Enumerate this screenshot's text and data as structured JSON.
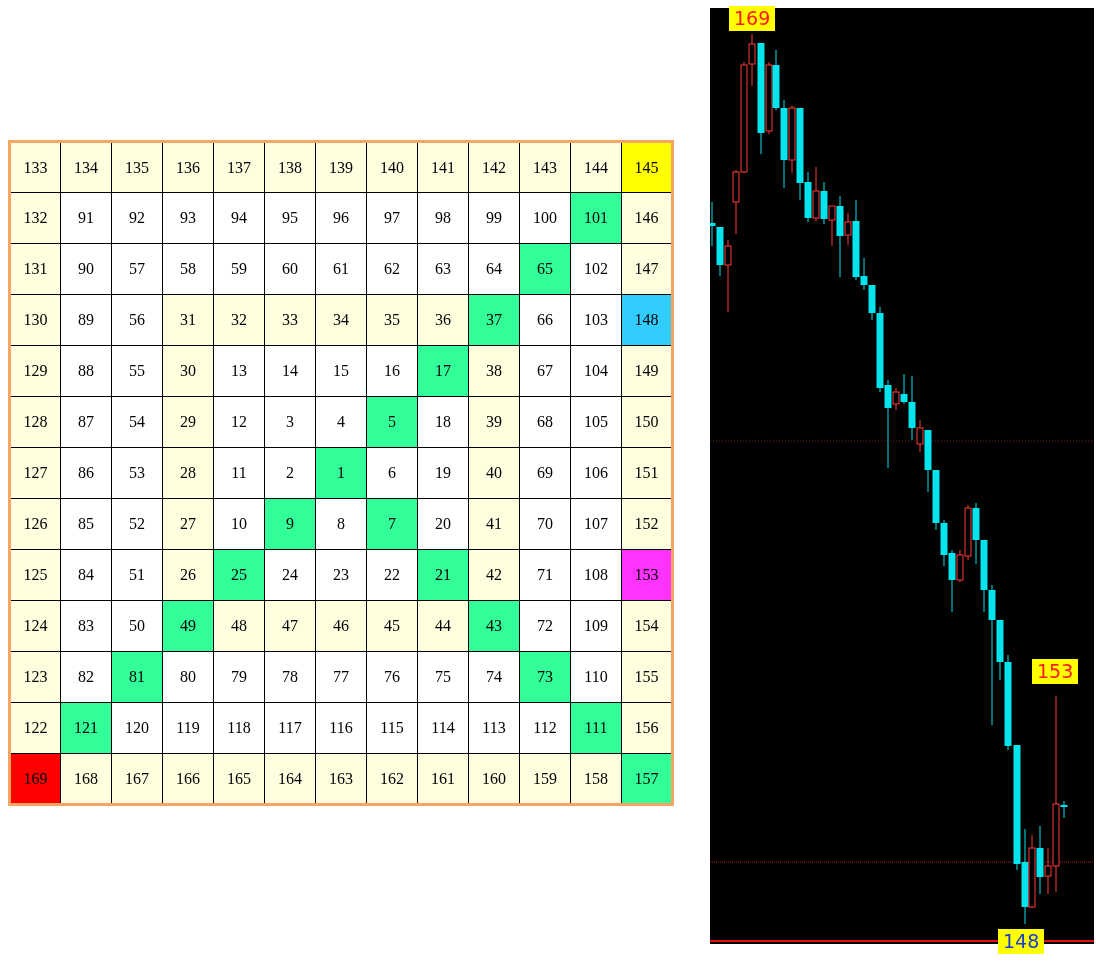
{
  "square": {
    "rows": [
      [
        {
          "text": "133",
          "color": "#ffffe0"
        },
        {
          "text": "134",
          "color": "#ffffe0"
        },
        {
          "text": "135",
          "color": "#ffffe0"
        },
        {
          "text": "136",
          "color": "#ffffe0"
        },
        {
          "text": "137",
          "color": "#ffffe0"
        },
        {
          "text": "138",
          "color": "#ffffe0"
        },
        {
          "text": "139",
          "color": "#ffffe0"
        },
        {
          "text": "140",
          "color": "#ffffe0"
        },
        {
          "text": "141",
          "color": "#ffffe0"
        },
        {
          "text": "142",
          "color": "#ffffe0"
        },
        {
          "text": "143",
          "color": "#ffffe0"
        },
        {
          "text": "144",
          "color": "#ffffe0"
        },
        {
          "text": "145",
          "color": "#ffff00"
        }
      ],
      [
        {
          "text": "132",
          "color": "#ffffe0"
        },
        {
          "text": "91",
          "color": "#ffffff"
        },
        {
          "text": "92",
          "color": "#ffffff"
        },
        {
          "text": "93",
          "color": "#ffffff"
        },
        {
          "text": "94",
          "color": "#ffffff"
        },
        {
          "text": "95",
          "color": "#ffffff"
        },
        {
          "text": "96",
          "color": "#ffffff"
        },
        {
          "text": "97",
          "color": "#ffffff"
        },
        {
          "text": "98",
          "color": "#ffffff"
        },
        {
          "text": "99",
          "color": "#ffffff"
        },
        {
          "text": "100",
          "color": "#ffffff"
        },
        {
          "text": "101",
          "color": "#33ff99"
        },
        {
          "text": "146",
          "color": "#ffffe0"
        }
      ],
      [
        {
          "text": "131",
          "color": "#ffffe0"
        },
        {
          "text": "90",
          "color": "#ffffff"
        },
        {
          "text": "57",
          "color": "#ffffff"
        },
        {
          "text": "58",
          "color": "#ffffff"
        },
        {
          "text": "59",
          "color": "#ffffff"
        },
        {
          "text": "60",
          "color": "#ffffff"
        },
        {
          "text": "61",
          "color": "#ffffff"
        },
        {
          "text": "62",
          "color": "#ffffff"
        },
        {
          "text": "63",
          "color": "#ffffff"
        },
        {
          "text": "64",
          "color": "#ffffff"
        },
        {
          "text": "65",
          "color": "#33ff99"
        },
        {
          "text": "102",
          "color": "#ffffff"
        },
        {
          "text": "147",
          "color": "#ffffe0"
        }
      ],
      [
        {
          "text": "130",
          "color": "#ffffe0"
        },
        {
          "text": "89",
          "color": "#ffffff"
        },
        {
          "text": "56",
          "color": "#ffffff"
        },
        {
          "text": "31",
          "color": "#ffffe0"
        },
        {
          "text": "32",
          "color": "#ffffe0"
        },
        {
          "text": "33",
          "color": "#ffffe0"
        },
        {
          "text": "34",
          "color": "#ffffe0"
        },
        {
          "text": "35",
          "color": "#ffffe0"
        },
        {
          "text": "36",
          "color": "#ffffe0"
        },
        {
          "text": "37",
          "color": "#33ff99"
        },
        {
          "text": "66",
          "color": "#ffffff"
        },
        {
          "text": "103",
          "color": "#ffffff"
        },
        {
          "text": "148",
          "color": "#33ccff"
        }
      ],
      [
        {
          "text": "129",
          "color": "#ffffe0"
        },
        {
          "text": "88",
          "color": "#ffffff"
        },
        {
          "text": "55",
          "color": "#ffffff"
        },
        {
          "text": "30",
          "color": "#ffffe0"
        },
        {
          "text": "13",
          "color": "#ffffff"
        },
        {
          "text": "14",
          "color": "#ffffff"
        },
        {
          "text": "15",
          "color": "#ffffff"
        },
        {
          "text": "16",
          "color": "#ffffff"
        },
        {
          "text": "17",
          "color": "#33ff99"
        },
        {
          "text": "38",
          "color": "#ffffe0"
        },
        {
          "text": "67",
          "color": "#ffffff"
        },
        {
          "text": "104",
          "color": "#ffffff"
        },
        {
          "text": "149",
          "color": "#ffffe0"
        }
      ],
      [
        {
          "text": "128",
          "color": "#ffffe0"
        },
        {
          "text": "87",
          "color": "#ffffff"
        },
        {
          "text": "54",
          "color": "#ffffff"
        },
        {
          "text": "29",
          "color": "#ffffe0"
        },
        {
          "text": "12",
          "color": "#ffffff"
        },
        {
          "text": "3",
          "color": "#ffffff"
        },
        {
          "text": "4",
          "color": "#ffffff"
        },
        {
          "text": "5",
          "color": "#33ff99"
        },
        {
          "text": "18",
          "color": "#ffffff"
        },
        {
          "text": "39",
          "color": "#ffffe0"
        },
        {
          "text": "68",
          "color": "#ffffff"
        },
        {
          "text": "105",
          "color": "#ffffff"
        },
        {
          "text": "150",
          "color": "#ffffe0"
        }
      ],
      [
        {
          "text": "127",
          "color": "#ffffe0"
        },
        {
          "text": "86",
          "color": "#ffffff"
        },
        {
          "text": "53",
          "color": "#ffffff"
        },
        {
          "text": "28",
          "color": "#ffffe0"
        },
        {
          "text": "11",
          "color": "#ffffff"
        },
        {
          "text": "2",
          "color": "#ffffff"
        },
        {
          "text": "1",
          "color": "#33ff99"
        },
        {
          "text": "6",
          "color": "#ffffff"
        },
        {
          "text": "19",
          "color": "#ffffff"
        },
        {
          "text": "40",
          "color": "#ffffe0"
        },
        {
          "text": "69",
          "color": "#ffffff"
        },
        {
          "text": "106",
          "color": "#ffffff"
        },
        {
          "text": "151",
          "color": "#ffffe0"
        }
      ],
      [
        {
          "text": "126",
          "color": "#ffffe0"
        },
        {
          "text": "85",
          "color": "#ffffff"
        },
        {
          "text": "52",
          "color": "#ffffff"
        },
        {
          "text": "27",
          "color": "#ffffe0"
        },
        {
          "text": "10",
          "color": "#ffffff"
        },
        {
          "text": "9",
          "color": "#33ff99"
        },
        {
          "text": "8",
          "color": "#ffffff"
        },
        {
          "text": "7",
          "color": "#33ff99"
        },
        {
          "text": "20",
          "color": "#ffffff"
        },
        {
          "text": "41",
          "color": "#ffffe0"
        },
        {
          "text": "70",
          "color": "#ffffff"
        },
        {
          "text": "107",
          "color": "#ffffff"
        },
        {
          "text": "152",
          "color": "#ffffe0"
        }
      ],
      [
        {
          "text": "125",
          "color": "#ffffe0"
        },
        {
          "text": "84",
          "color": "#ffffff"
        },
        {
          "text": "51",
          "color": "#ffffff"
        },
        {
          "text": "26",
          "color": "#ffffe0"
        },
        {
          "text": "25",
          "color": "#33ff99"
        },
        {
          "text": "24",
          "color": "#ffffff"
        },
        {
          "text": "23",
          "color": "#ffffff"
        },
        {
          "text": "22",
          "color": "#ffffff"
        },
        {
          "text": "21",
          "color": "#33ff99"
        },
        {
          "text": "42",
          "color": "#ffffe0"
        },
        {
          "text": "71",
          "color": "#ffffff"
        },
        {
          "text": "108",
          "color": "#ffffff"
        },
        {
          "text": "153",
          "color": "#ff33ff"
        }
      ],
      [
        {
          "text": "124",
          "color": "#ffffe0"
        },
        {
          "text": "83",
          "color": "#ffffff"
        },
        {
          "text": "50",
          "color": "#ffffff"
        },
        {
          "text": "49",
          "color": "#33ff99"
        },
        {
          "text": "48",
          "color": "#ffffe0"
        },
        {
          "text": "47",
          "color": "#ffffe0"
        },
        {
          "text": "46",
          "color": "#ffffe0"
        },
        {
          "text": "45",
          "color": "#ffffe0"
        },
        {
          "text": "44",
          "color": "#ffffe0"
        },
        {
          "text": "43",
          "color": "#33ff99"
        },
        {
          "text": "72",
          "color": "#ffffff"
        },
        {
          "text": "109",
          "color": "#ffffff"
        },
        {
          "text": "154",
          "color": "#ffffe0"
        }
      ],
      [
        {
          "text": "123",
          "color": "#ffffe0"
        },
        {
          "text": "82",
          "color": "#ffffff"
        },
        {
          "text": "81",
          "color": "#33ff99"
        },
        {
          "text": "80",
          "color": "#ffffff"
        },
        {
          "text": "79",
          "color": "#ffffff"
        },
        {
          "text": "78",
          "color": "#ffffff"
        },
        {
          "text": "77",
          "color": "#ffffff"
        },
        {
          "text": "76",
          "color": "#ffffff"
        },
        {
          "text": "75",
          "color": "#ffffff"
        },
        {
          "text": "74",
          "color": "#ffffff"
        },
        {
          "text": "73",
          "color": "#33ff99"
        },
        {
          "text": "110",
          "color": "#ffffff"
        },
        {
          "text": "155",
          "color": "#ffffe0"
        }
      ],
      [
        {
          "text": "122",
          "color": "#ffffe0"
        },
        {
          "text": "121",
          "color": "#33ff99"
        },
        {
          "text": "120",
          "color": "#ffffff"
        },
        {
          "text": "119",
          "color": "#ffffff"
        },
        {
          "text": "118",
          "color": "#ffffff"
        },
        {
          "text": "117",
          "color": "#ffffff"
        },
        {
          "text": "116",
          "color": "#ffffff"
        },
        {
          "text": "115",
          "color": "#ffffff"
        },
        {
          "text": "114",
          "color": "#ffffff"
        },
        {
          "text": "113",
          "color": "#ffffff"
        },
        {
          "text": "112",
          "color": "#ffffff"
        },
        {
          "text": "111",
          "color": "#33ff99"
        },
        {
          "text": "156",
          "color": "#ffffe0"
        }
      ],
      [
        {
          "text": "169",
          "color": "#ff0000"
        },
        {
          "text": "168",
          "color": "#ffffe0"
        },
        {
          "text": "167",
          "color": "#ffffe0"
        },
        {
          "text": "166",
          "color": "#ffffe0"
        },
        {
          "text": "165",
          "color": "#ffffe0"
        },
        {
          "text": "164",
          "color": "#ffffe0"
        },
        {
          "text": "163",
          "color": "#ffffe0"
        },
        {
          "text": "162",
          "color": "#ffffe0"
        },
        {
          "text": "161",
          "color": "#ffffe0"
        },
        {
          "text": "160",
          "color": "#ffffe0"
        },
        {
          "text": "159",
          "color": "#ffffe0"
        },
        {
          "text": "158",
          "color": "#ffffe0"
        },
        {
          "text": "157",
          "color": "#33ff99"
        }
      ]
    ]
  },
  "chart": {
    "labels": [
      {
        "kind": "high",
        "text": "169"
      },
      {
        "kind": "rebound",
        "text": "153"
      },
      {
        "kind": "low",
        "text": "148"
      }
    ]
  }
}
